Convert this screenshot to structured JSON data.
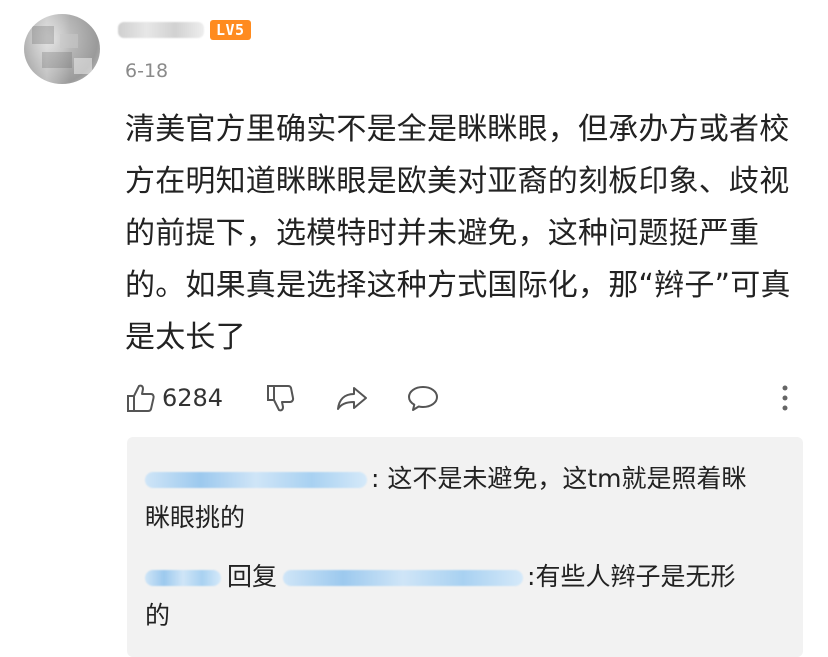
{
  "comment": {
    "author": {
      "name": "",
      "level_badge": "LV5",
      "level_badge_color": "#ff8b1f"
    },
    "date": "6-18",
    "text": "清美官方里确实不是全是眯眯眼，但承办方或者校\n方在明知道眯眯眼是欧美对亚裔的刻板印象、歧视\n的前提下，选模特时并未避免，这种问题挺严重\n的。如果真是选择这种方式国际化，那“辫子”可真\n是太长了",
    "actions": {
      "like_count": "6284",
      "like_icon": "thumbs-up-icon",
      "dislike_icon": "thumbs-down-icon",
      "share_icon": "share-arrow-icon",
      "comment_icon": "speech-bubble-icon",
      "more_icon": "vertical-dots-icon"
    }
  },
  "replies": [
    {
      "author": "",
      "text": ": 这不是未避免，这tm就是照着眯\n眯眼挑的"
    },
    {
      "author": "",
      "reply_word": "回复",
      "reply_to": "",
      "text": ":有些人辫子是无形\n的"
    }
  ],
  "colors": {
    "text": "#222222",
    "muted": "#8a8a8a",
    "reply_bg": "#f2f2f2",
    "username_link": "#3f8fd8"
  }
}
